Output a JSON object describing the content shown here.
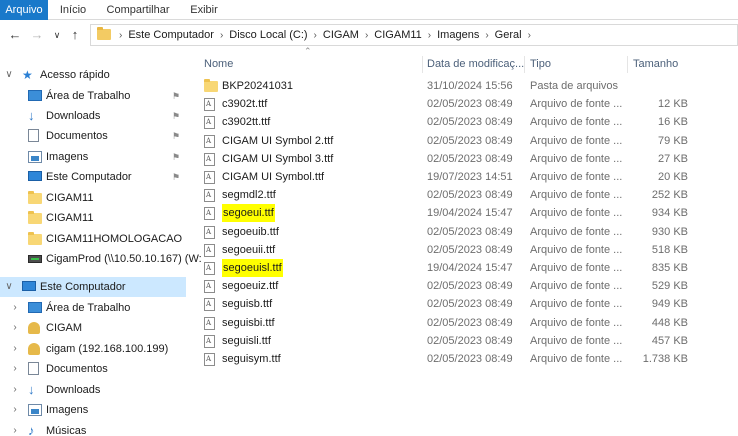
{
  "ribbon": {
    "tabs": [
      "Arquivo",
      "Início",
      "Compartilhar",
      "Exibir"
    ]
  },
  "address": {
    "crumbs": [
      "Este Computador",
      "Disco Local (C:)",
      "CIGAM",
      "CIGAM11",
      "Imagens",
      "Geral"
    ],
    "back_icon": "arrow-left-icon",
    "forward_icon": "arrow-right-icon",
    "recent_icon": "chevron-down-icon",
    "up_icon": "arrow-up-icon"
  },
  "columns": {
    "name": "Nome",
    "date": "Data de modificaç...",
    "type": "Tipo",
    "size": "Tamanho"
  },
  "nav": [
    {
      "label": "Acesso rápido",
      "icon": "star-icon",
      "level": 0,
      "chevron": "v",
      "pinned": false
    },
    {
      "label": "Área de Trabalho",
      "icon": "desktop-icon",
      "level": 1,
      "pinned": true
    },
    {
      "label": "Downloads",
      "icon": "download-icon",
      "level": 1,
      "pinned": true
    },
    {
      "label": "Documentos",
      "icon": "document-icon",
      "level": 1,
      "pinned": true
    },
    {
      "label": "Imagens",
      "icon": "pictures-icon",
      "level": 1,
      "pinned": true
    },
    {
      "label": "Este Computador",
      "icon": "computer-icon",
      "level": 1,
      "pinned": true
    },
    {
      "label": "CIGAM11",
      "icon": "folder-icon",
      "level": 1,
      "pinned": false
    },
    {
      "label": "CIGAM11",
      "icon": "folder-icon",
      "level": 1,
      "pinned": false
    },
    {
      "label": "CIGAM11HOMOLOGACAO",
      "icon": "folder-icon",
      "level": 1,
      "pinned": false
    },
    {
      "label": "CigamProd (\\\\10.50.10.167) (W:",
      "icon": "network-drive-icon",
      "level": 1,
      "pinned": false
    },
    {
      "label": "Este Computador",
      "icon": "computer-icon",
      "level": 0,
      "chevron": "v",
      "pinned": false,
      "selected": true
    },
    {
      "label": "Área de Trabalho",
      "icon": "desktop-icon",
      "level": 1,
      "chevron": ">",
      "pinned": false
    },
    {
      "label": "CIGAM",
      "icon": "user-folder-icon",
      "level": 1,
      "chevron": ">",
      "pinned": false
    },
    {
      "label": "cigam (192.168.100.199)",
      "icon": "user-folder-icon",
      "level": 1,
      "chevron": ">",
      "pinned": false
    },
    {
      "label": "Documentos",
      "icon": "document-icon",
      "level": 1,
      "chevron": ">",
      "pinned": false
    },
    {
      "label": "Downloads",
      "icon": "download-icon",
      "level": 1,
      "chevron": ">",
      "pinned": false
    },
    {
      "label": "Imagens",
      "icon": "pictures-icon",
      "level": 1,
      "chevron": ">",
      "pinned": false
    },
    {
      "label": "Músicas",
      "icon": "music-icon",
      "level": 1,
      "chevron": ">",
      "pinned": false
    }
  ],
  "files": [
    {
      "name": "BKP20241031",
      "date": "31/10/2024 15:56",
      "type": "Pasta de arquivos",
      "size": "",
      "icon": "folder-icon",
      "highlighted": false
    },
    {
      "name": "c3902t.ttf",
      "date": "02/05/2023 08:49",
      "type": "Arquivo de fonte ...",
      "size": "12 KB",
      "icon": "font-file-icon",
      "highlighted": false
    },
    {
      "name": "c3902tt.ttf",
      "date": "02/05/2023 08:49",
      "type": "Arquivo de fonte ...",
      "size": "16 KB",
      "icon": "font-file-icon",
      "highlighted": false
    },
    {
      "name": "CIGAM UI Symbol 2.ttf",
      "date": "02/05/2023 08:49",
      "type": "Arquivo de fonte ...",
      "size": "79 KB",
      "icon": "font-file-icon",
      "highlighted": false
    },
    {
      "name": "CIGAM UI Symbol 3.ttf",
      "date": "02/05/2023 08:49",
      "type": "Arquivo de fonte ...",
      "size": "27 KB",
      "icon": "font-file-icon",
      "highlighted": false
    },
    {
      "name": "CIGAM UI Symbol.ttf",
      "date": "19/07/2023 14:51",
      "type": "Arquivo de fonte ...",
      "size": "20 KB",
      "icon": "font-file-icon",
      "highlighted": false
    },
    {
      "name": "segmdl2.ttf",
      "date": "02/05/2023 08:49",
      "type": "Arquivo de fonte ...",
      "size": "252 KB",
      "icon": "font-file-icon",
      "highlighted": false
    },
    {
      "name": "segoeui.ttf",
      "date": "19/04/2024 15:47",
      "type": "Arquivo de fonte ...",
      "size": "934 KB",
      "icon": "font-file-icon",
      "highlighted": true
    },
    {
      "name": "segoeuib.ttf",
      "date": "02/05/2023 08:49",
      "type": "Arquivo de fonte ...",
      "size": "930 KB",
      "icon": "font-file-icon",
      "highlighted": false
    },
    {
      "name": "segoeuii.ttf",
      "date": "02/05/2023 08:49",
      "type": "Arquivo de fonte ...",
      "size": "518 KB",
      "icon": "font-file-icon",
      "highlighted": false
    },
    {
      "name": "segoeuisl.ttf",
      "date": "19/04/2024 15:47",
      "type": "Arquivo de fonte ...",
      "size": "835 KB",
      "icon": "font-file-icon",
      "highlighted": true
    },
    {
      "name": "segoeuiz.ttf",
      "date": "02/05/2023 08:49",
      "type": "Arquivo de fonte ...",
      "size": "529 KB",
      "icon": "font-file-icon",
      "highlighted": false
    },
    {
      "name": "seguisb.ttf",
      "date": "02/05/2023 08:49",
      "type": "Arquivo de fonte ...",
      "size": "949 KB",
      "icon": "font-file-icon",
      "highlighted": false
    },
    {
      "name": "seguisbi.ttf",
      "date": "02/05/2023 08:49",
      "type": "Arquivo de fonte ...",
      "size": "448 KB",
      "icon": "font-file-icon",
      "highlighted": false
    },
    {
      "name": "seguisli.ttf",
      "date": "02/05/2023 08:49",
      "type": "Arquivo de fonte ...",
      "size": "457 KB",
      "icon": "font-file-icon",
      "highlighted": false
    },
    {
      "name": "seguisym.ttf",
      "date": "02/05/2023 08:49",
      "type": "Arquivo de fonte ...",
      "size": "1.738 KB",
      "icon": "font-file-icon",
      "highlighted": false
    }
  ],
  "colors": {
    "accent": "#1979ca",
    "selection": "#cce8ff",
    "highlight": "#ffff00",
    "header_text": "#4c607a"
  }
}
